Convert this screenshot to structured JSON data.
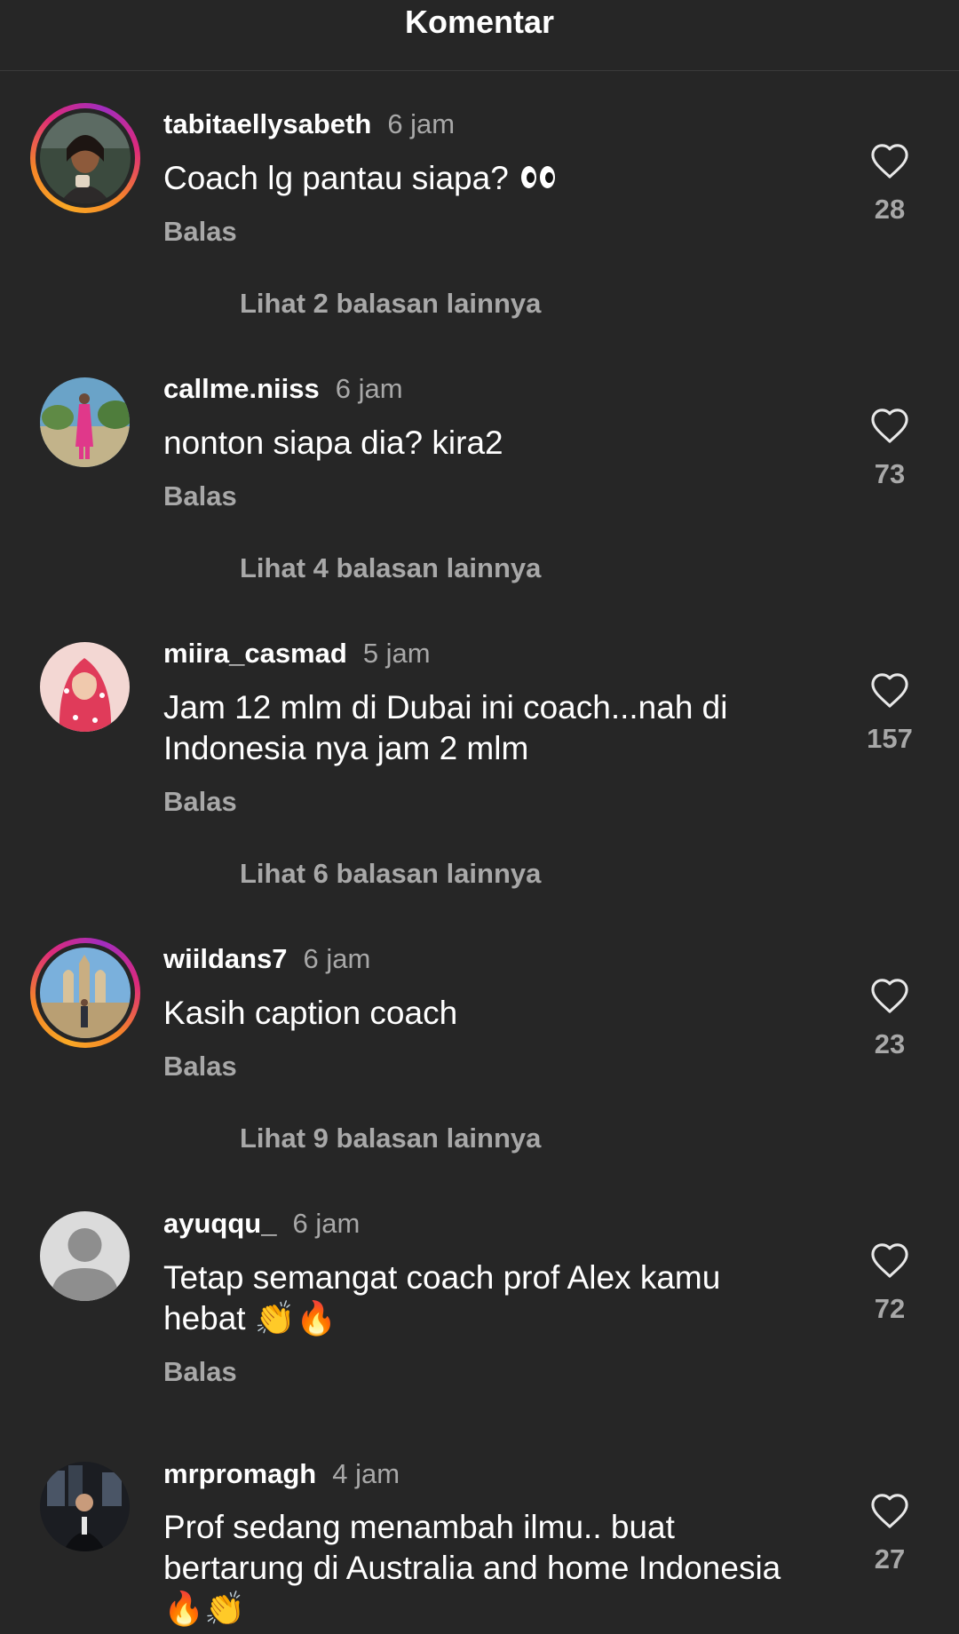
{
  "header": {
    "title": "Komentar"
  },
  "reply_label": "Balas",
  "comments": [
    {
      "username": "tabitaellysabeth",
      "time": "6 jam",
      "text": "Coach lg pantau siapa?",
      "emoji": "👀",
      "likes": "28",
      "more_replies": "Lihat 2 balasan lainnya",
      "has_story": true
    },
    {
      "username": "callme.niiss",
      "time": "6 jam",
      "text": "nonton siapa dia? kira2",
      "likes": "73",
      "more_replies": "Lihat 4 balasan lainnya",
      "has_story": false
    },
    {
      "username": "miira_casmad",
      "time": "5 jam",
      "text": "Jam 12 mlm di Dubai ini coach...nah di Indonesia nya jam 2 mlm",
      "likes": "157",
      "more_replies": "Lihat 6 balasan lainnya",
      "has_story": false
    },
    {
      "username": "wiildans7",
      "time": "6 jam",
      "text": "Kasih caption coach",
      "likes": "23",
      "more_replies": "Lihat 9 balasan lainnya",
      "has_story": true
    },
    {
      "username": "ayuqqu_",
      "time": "6 jam",
      "text": "Tetap semangat coach prof Alex kamu hebat",
      "emoji": "👏🔥",
      "likes": "72",
      "has_story": false
    },
    {
      "username": "mrpromagh",
      "time": "4 jam",
      "text": "Prof sedang menambah ilmu.. buat bertarung di Australia and home Indonesia",
      "emoji": "🔥👏",
      "likes": "27",
      "has_story": false
    }
  ]
}
